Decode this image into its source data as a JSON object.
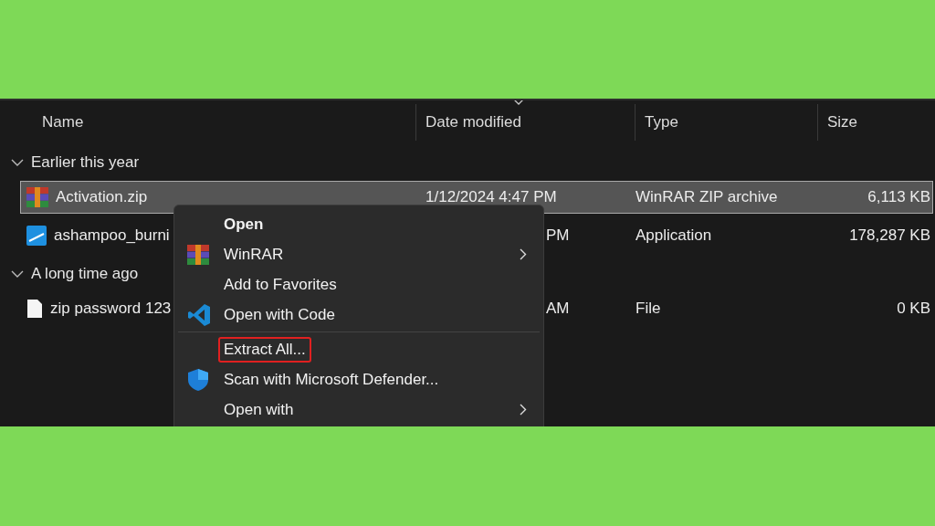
{
  "columns": [
    {
      "label": "Name",
      "sorted": false
    },
    {
      "label": "Date modified",
      "sorted": true
    },
    {
      "label": "Type",
      "sorted": false
    },
    {
      "label": "Size",
      "sorted": false
    }
  ],
  "groups": [
    {
      "label": "Earlier this year",
      "expanded": true,
      "files": [
        {
          "kind": "archive",
          "name": "Activation.zip",
          "date": "1/12/2024 4:47 PM",
          "date_hidden": false,
          "type": "WinRAR ZIP archive",
          "size": "6,113 KB",
          "selected": true
        },
        {
          "kind": "app",
          "name": "ashampoo_burni",
          "date": "PM",
          "date_hidden": true,
          "type": "Application",
          "size": "178,287 KB",
          "selected": false
        }
      ]
    },
    {
      "label": "A long time ago",
      "expanded": true,
      "files": [
        {
          "kind": "document",
          "name": "zip password 123",
          "date": "AM",
          "date_hidden": true,
          "type": "File",
          "size": "0 KB",
          "selected": false
        }
      ]
    }
  ],
  "context_menu": {
    "items": [
      {
        "kind": "plain",
        "label": "Open",
        "bold": true,
        "submenu": false,
        "highlighted": false,
        "divider_after": false
      },
      {
        "kind": "archive",
        "label": "WinRAR",
        "bold": false,
        "submenu": true,
        "highlighted": false,
        "divider_after": false
      },
      {
        "kind": "plain",
        "label": "Add to Favorites",
        "bold": false,
        "submenu": false,
        "highlighted": false,
        "divider_after": false
      },
      {
        "kind": "code",
        "label": "Open with Code",
        "bold": false,
        "submenu": false,
        "highlighted": false,
        "divider_after": true
      },
      {
        "kind": "plain",
        "label": "Extract All...",
        "bold": false,
        "submenu": false,
        "highlighted": true,
        "divider_after": false
      },
      {
        "kind": "shield",
        "label": "Scan with Microsoft Defender...",
        "bold": false,
        "submenu": false,
        "highlighted": false,
        "divider_after": false
      },
      {
        "kind": "plain",
        "label": "Open with",
        "bold": false,
        "submenu": true,
        "highlighted": false,
        "divider_after": false
      }
    ]
  }
}
